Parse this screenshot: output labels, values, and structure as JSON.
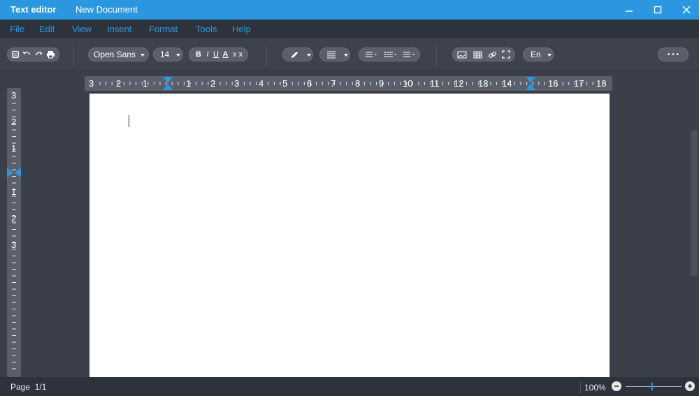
{
  "titlebar": {
    "app_title": "Text editor",
    "document_title": "New Document"
  },
  "menubar": {
    "items": [
      "File",
      "Edit",
      "View",
      "Insent",
      "Format",
      "Tools",
      "Help"
    ]
  },
  "toolbar": {
    "font_family": "Open Sans",
    "font_size": "14",
    "bold": "B",
    "italic": "I",
    "underline": "U",
    "font_color": "A",
    "clear_format": "x x",
    "language": "En",
    "more": "• • •"
  },
  "ruler": {
    "horizontal_labels": [
      "3",
      "2",
      "1",
      "1",
      "2",
      "3",
      "4",
      "5",
      "6",
      "7",
      "8",
      "9",
      "10",
      "11",
      "12",
      "13",
      "14",
      "16",
      "17",
      "18"
    ],
    "vertical_labels": [
      "3",
      "2",
      "1",
      "1",
      "2",
      "3"
    ]
  },
  "statusbar": {
    "page_label": "Page",
    "page_value": "1/1",
    "zoom": "100%"
  },
  "colors": {
    "accent": "#2a97e0",
    "titlebar": "#2a97e0",
    "chrome": "#3a3f49",
    "page": "#ffffff"
  }
}
